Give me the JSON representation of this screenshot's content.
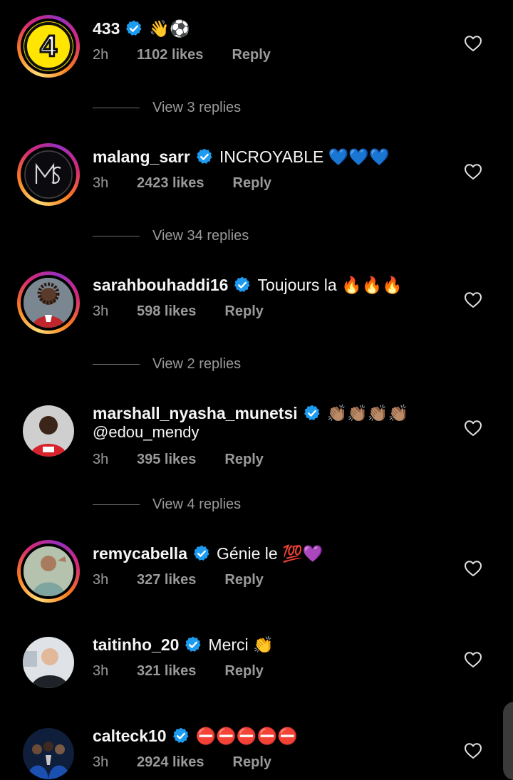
{
  "comments": [
    {
      "username": "433",
      "text": "👋⚽",
      "time": "2h",
      "likes": "1102 likes",
      "reply": "Reply",
      "view_replies": "View 3 replies"
    },
    {
      "username": "malang_sarr",
      "text": "INCROYABLE 💙💙💙",
      "time": "3h",
      "likes": "2423 likes",
      "reply": "Reply",
      "view_replies": "View 34 replies"
    },
    {
      "username": "sarahbouhaddi16",
      "text": "Toujours la 🔥🔥🔥",
      "time": "3h",
      "likes": "598 likes",
      "reply": "Reply",
      "view_replies": "View 2 replies"
    },
    {
      "username": "marshall_nyasha_munetsi",
      "text": "👏🏽👏🏽👏🏽👏🏽",
      "text2": "@edou_mendy",
      "time": "3h",
      "likes": "395 likes",
      "reply": "Reply",
      "view_replies": "View 4 replies"
    },
    {
      "username": "remycabella",
      "text": "Génie le 💯💜",
      "time": "3h",
      "likes": "327 likes",
      "reply": "Reply"
    },
    {
      "username": "taitinho_20",
      "text": "Merci 👏",
      "time": "3h",
      "likes": "321 likes",
      "reply": "Reply"
    },
    {
      "username": "calteck10",
      "text": "⛔⛔⛔⛔⛔",
      "time": "3h",
      "likes": "2924 likes",
      "reply": "Reply"
    }
  ],
  "avatar_433_label": "4",
  "colors": {
    "background": "#000000",
    "text": "#f5f5f5",
    "secondary": "#9a9a9a",
    "verified": "#1d9bf0"
  }
}
